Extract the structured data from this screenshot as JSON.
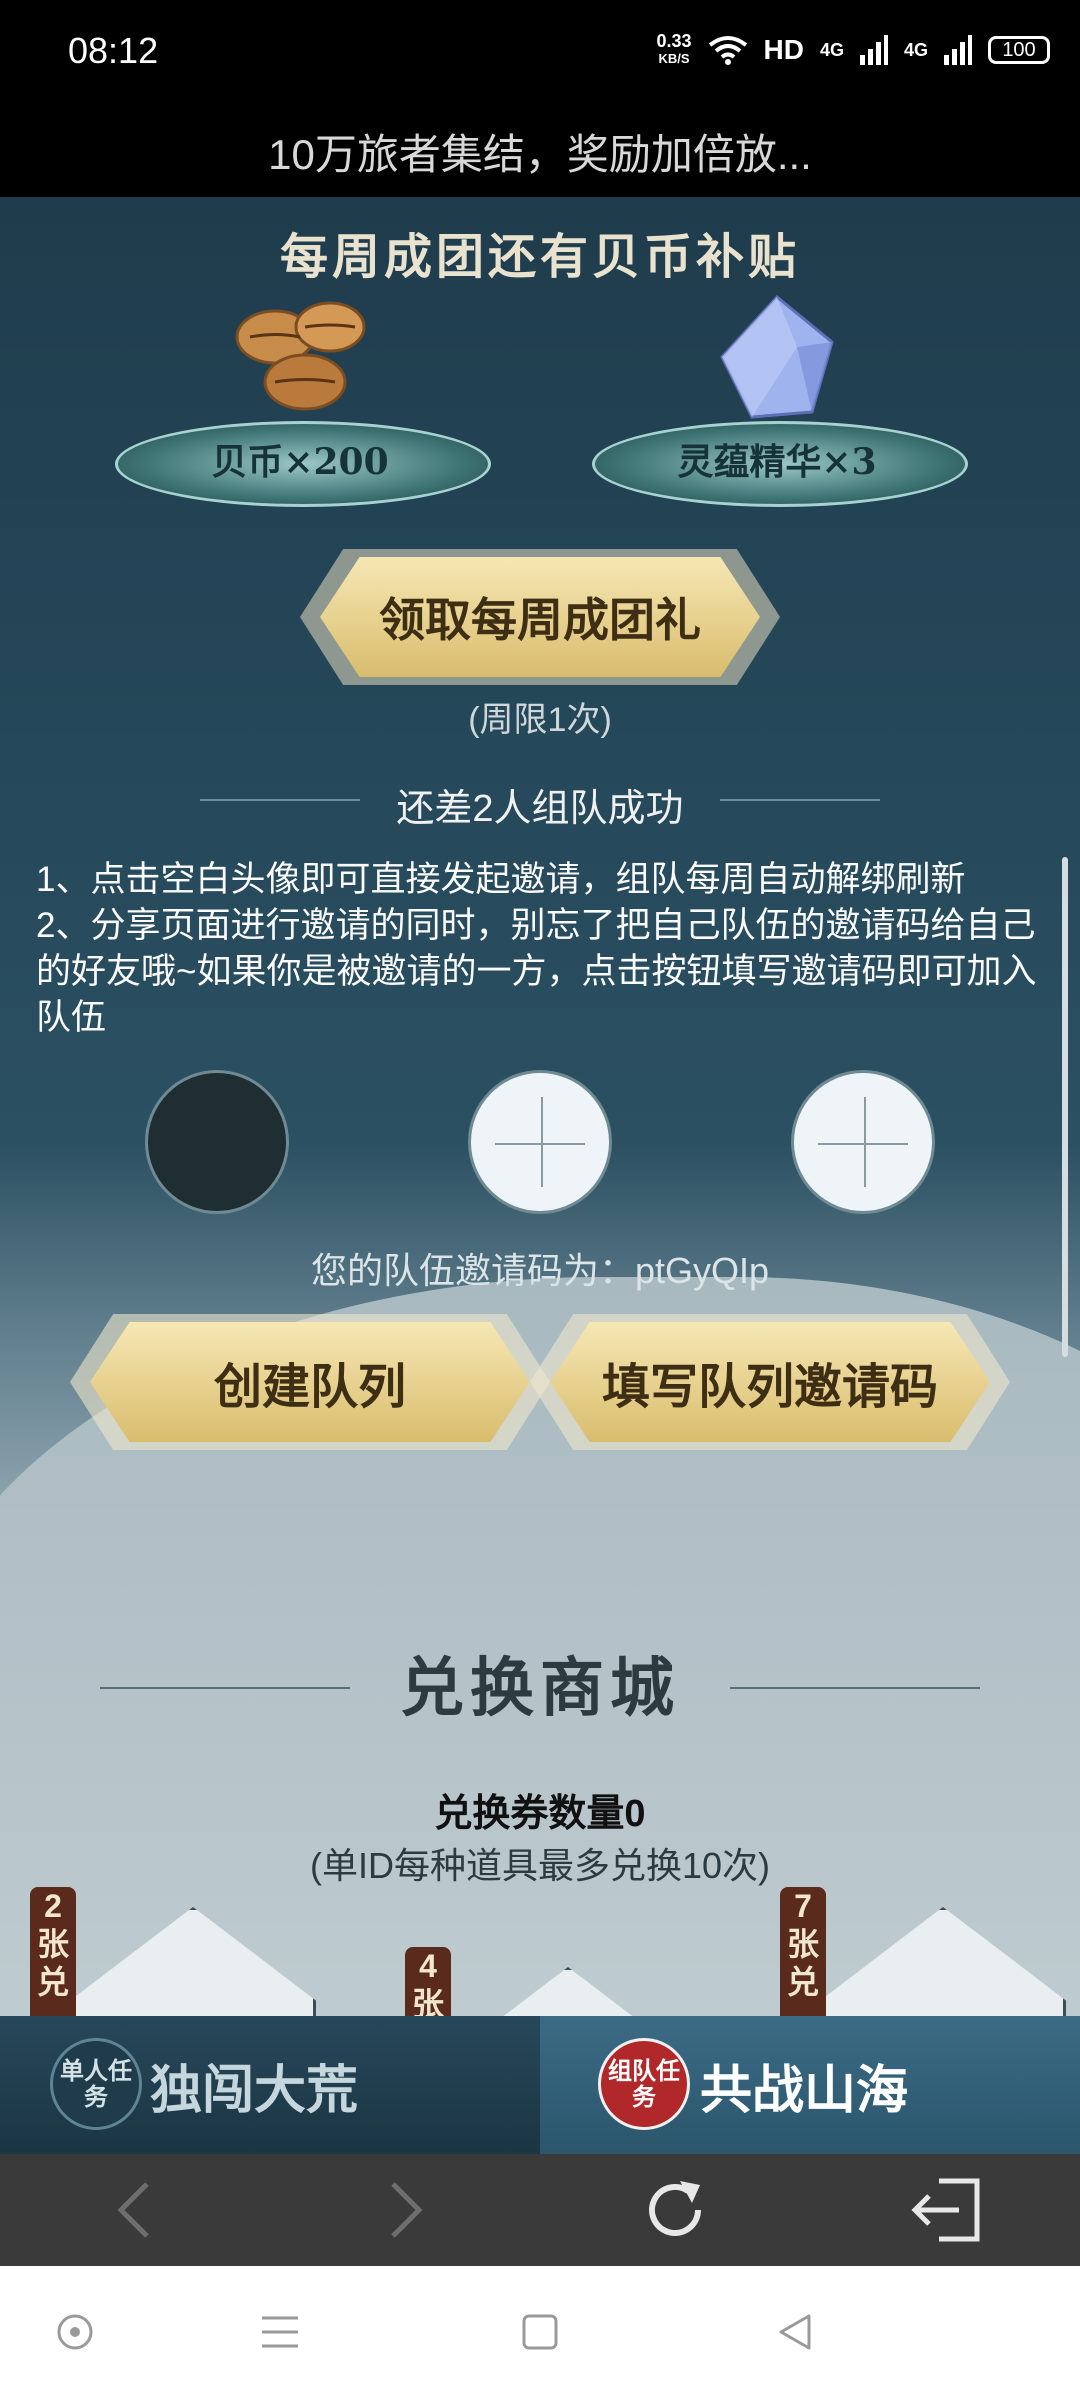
{
  "status_bar": {
    "time": "08:12",
    "net_speed_value": "0.33",
    "net_speed_unit": "KB/S",
    "hd_label": "HD",
    "signal1": "4G",
    "signal2": "4G",
    "battery": "100"
  },
  "header": {
    "title": "10万旅者集结，奖励加倍放..."
  },
  "weekly": {
    "title": "每周成团还有贝币补贴",
    "rewards": [
      {
        "label": "贝币×200",
        "icon": "shell-coin-icon"
      },
      {
        "label": "灵蕴精华×3",
        "icon": "crystal-icon"
      }
    ],
    "claim_button": "领取每周成团礼",
    "limit": "(周限1次)"
  },
  "team": {
    "status": "还差2人组队成功",
    "instructions": [
      "1、点击空白头像即可直接发起邀请，组队每周自动解绑刷新",
      "2、分享页面进行邀请的同时，别忘了把自己队伍的邀请码给自己的好友哦~如果你是被邀请的一方，点击按钮填写邀请码即可加入队伍"
    ],
    "invite_code_text": "您的队伍邀请码为：ptGyQIp",
    "create_button": "创建队列",
    "fill_button": "填写队列邀请码"
  },
  "shop": {
    "title": "兑换商城",
    "voucher_count": "兑换券数量0",
    "limit_note": "(单ID每种道具最多兑换10次)",
    "cards": [
      {
        "tag": "2张兑"
      },
      {
        "tag": "4张"
      },
      {
        "tag": "7张兑"
      }
    ]
  },
  "tabs": {
    "solo_badge": "单人任务",
    "solo_label": "独闯大荒",
    "team_badge": "组队任务",
    "team_label": "共战山海"
  },
  "colors": {
    "gold_button": "#d9bd6e",
    "team_tab": "#3b6b84",
    "badge_red": "#b0282a"
  }
}
